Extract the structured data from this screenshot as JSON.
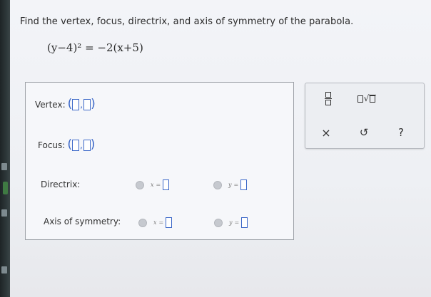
{
  "question": "Find the vertex, focus, directrix, and axis of symmetry of the parabola.",
  "equation": "(y−4)² = −2(x+5)",
  "answers": {
    "vertex_label": "Vertex:",
    "focus_label": "Focus:",
    "directrix_label": "Directrix:",
    "axis_label": "Axis of symmetry:",
    "x_eq": "x",
    "y_eq": "y",
    "equals": "="
  },
  "palette": {
    "fraction_icon": "fraction-icon",
    "sqrt_icon": "sqrt-icon",
    "clear_symbol": "×",
    "undo_symbol": "↺",
    "help_symbol": "?"
  }
}
